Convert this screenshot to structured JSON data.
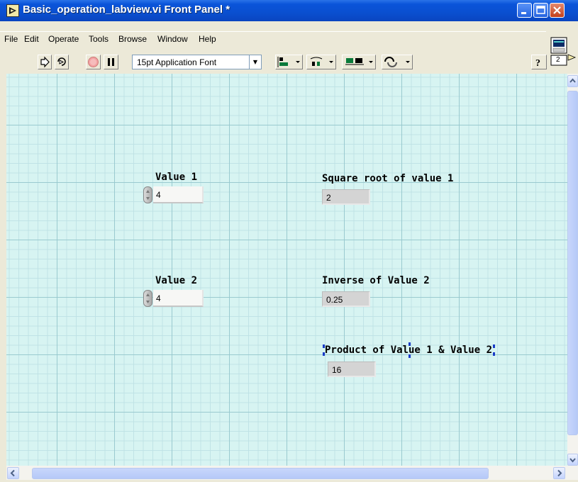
{
  "window": {
    "title": "Basic_operation_labview.vi Front Panel *",
    "controls": {
      "minimize": "_",
      "maximize": "□",
      "close": "X"
    }
  },
  "menu": {
    "items": [
      "File",
      "Edit",
      "Operate",
      "Tools",
      "Browse",
      "Window",
      "Help"
    ]
  },
  "toolbar": {
    "font_select": "15pt Application Font",
    "connector_label": "2"
  },
  "panel": {
    "value1": {
      "label": "Value 1",
      "value": "4"
    },
    "value2": {
      "label": "Value 2",
      "value": "4"
    },
    "sqrt": {
      "label": "Square root of value 1",
      "value": "2"
    },
    "inverse": {
      "label": "Inverse of Value 2",
      "value": "0.25"
    },
    "product": {
      "label": "Product of Value 1 & Value 2",
      "value": "16"
    }
  },
  "colors": {
    "panel_bg": "#d7f4f2",
    "titlebar": "#0a54d9"
  }
}
